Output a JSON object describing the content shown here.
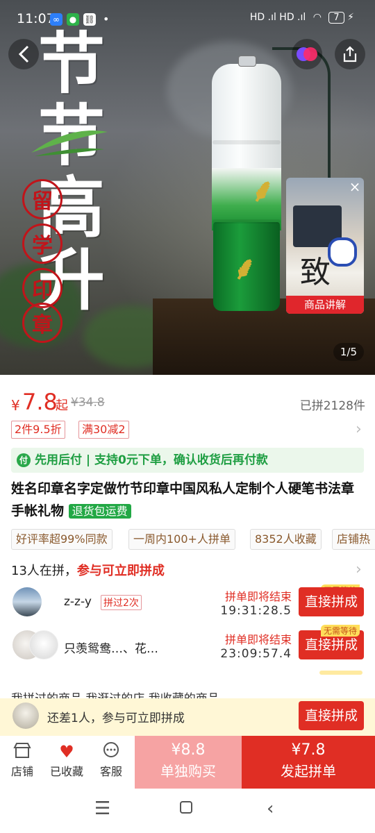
{
  "status": {
    "time": "11:07",
    "battery": "7",
    "signal": "HD .ıl HD .ıl"
  },
  "hero": {
    "big_title": "节节高升",
    "seal_chars": [
      "留",
      "学",
      "印",
      "章"
    ],
    "live_label": "商品讲解",
    "live_char": "致",
    "page_indicator": "1/5"
  },
  "price": {
    "currency": "¥",
    "value": "7.8",
    "suffix": "起",
    "original": "¥34.8",
    "sold": "已拼2128件"
  },
  "promos": [
    "2件9.5折",
    "满30减2"
  ],
  "pay_later": "先用后付 | 支持0元下单，确认收货后再付款",
  "title": "姓名印章名字定做竹节印章中国风私人定制个人硬笔书法章手帐礼物",
  "return_badge": "退货包运费",
  "chips": [
    "好评率超99%同款",
    "一周内100+人拼单",
    "8352人收藏",
    "店铺热"
  ],
  "group": {
    "count_text": "13人在拼，",
    "join_text": "参与可立即拼成",
    "rows": [
      {
        "name": "z-z-y",
        "badge": "拼过2次",
        "ending": "拼单即将结束",
        "countdown": "19:31:28.5",
        "button": "直接拼成",
        "nowait": "无需等待"
      },
      {
        "name": "只羡鸳鸯…、花…",
        "badge": "",
        "ending": "拼单即将结束",
        "countdown": "23:09:57.4",
        "button": "直接拼成",
        "nowait": "无需等待"
      }
    ]
  },
  "tabs_peek": "我拼过的商品    我逛过的店    我收藏的商品",
  "join_bar": {
    "text": "还差1人，参与可立即拼成",
    "button": "直接拼成"
  },
  "actions": {
    "store": "店铺",
    "favorited": "已收藏",
    "service": "客服",
    "solo_price": "¥8.8",
    "solo_label": "单独购买",
    "group_price": "¥7.8",
    "group_label": "发起拼单"
  }
}
